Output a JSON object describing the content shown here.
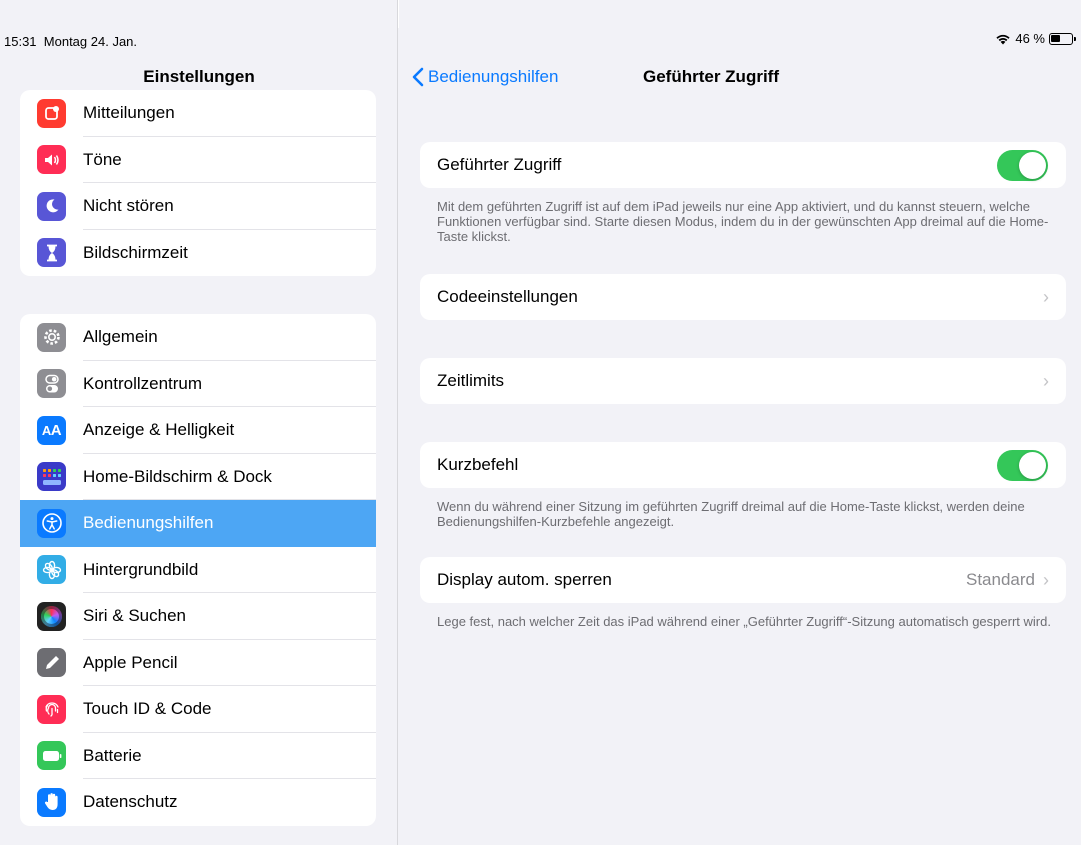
{
  "status": {
    "time": "15:31",
    "date": "Montag 24. Jan.",
    "battery": "46 %"
  },
  "sidebar": {
    "title": "Einstellungen",
    "group1": [
      {
        "label": "Mitteilungen",
        "icon": "bell-icon",
        "color": "#ff3b30"
      },
      {
        "label": "Töne",
        "icon": "speaker-icon",
        "color": "#ff2d55"
      },
      {
        "label": "Nicht stören",
        "icon": "moon-icon",
        "color": "#5856d6"
      },
      {
        "label": "Bildschirmzeit",
        "icon": "hourglass-icon",
        "color": "#5856d6"
      }
    ],
    "group2": [
      {
        "label": "Allgemein",
        "icon": "gear-icon",
        "color": "#8e8e93"
      },
      {
        "label": "Kontrollzentrum",
        "icon": "toggles-icon",
        "color": "#8e8e93"
      },
      {
        "label": "Anzeige & Helligkeit",
        "icon": "text-size-icon",
        "color": "#0a7aff"
      },
      {
        "label": "Home-Bildschirm & Dock",
        "icon": "grid-icon",
        "color": "#3a3ac8"
      },
      {
        "label": "Bedienungshilfen",
        "icon": "accessibility-icon",
        "color": "#0a7aff",
        "selected": true
      },
      {
        "label": "Hintergrundbild",
        "icon": "flower-icon",
        "color": "#32ade6"
      },
      {
        "label": "Siri & Suchen",
        "icon": "siri-icon",
        "color": "#222222"
      },
      {
        "label": "Apple Pencil",
        "icon": "pencil-icon",
        "color": "#6d6d72"
      },
      {
        "label": "Touch ID & Code",
        "icon": "fingerprint-icon",
        "color": "#ff2d55"
      },
      {
        "label": "Batterie",
        "icon": "battery-icon",
        "color": "#34c759"
      },
      {
        "label": "Datenschutz",
        "icon": "hand-icon",
        "color": "#0a7aff"
      }
    ]
  },
  "nav": {
    "back_label": "Bedienungshilfen",
    "title": "Geführter Zugriff"
  },
  "main": {
    "guided_access": {
      "label": "Geführter Zugriff",
      "on": true,
      "note": "Mit dem geführten Zugriff ist auf dem iPad jeweils nur eine App aktiviert, und du kannst steuern, welche Funktionen verfügbar sind. Starte diesen Modus, indem du in der gewünschten App dreimal auf die Home-Taste klickst."
    },
    "passcode": {
      "label": "Codeeinstellungen"
    },
    "time_limits": {
      "label": "Zeitlimits"
    },
    "shortcut": {
      "label": "Kurzbefehl",
      "on": true,
      "note": "Wenn du während einer Sitzung im geführten Zugriff dreimal auf die Home-Taste klickst, werden deine Bedienungshilfen-Kurzbefehle angezeigt."
    },
    "auto_lock": {
      "label": "Display autom. sperren",
      "value": "Standard",
      "note": "Lege fest, nach welcher Zeit das iPad während einer „Geführter Zugriff“-Sitzung automatisch gesperrt wird."
    }
  }
}
